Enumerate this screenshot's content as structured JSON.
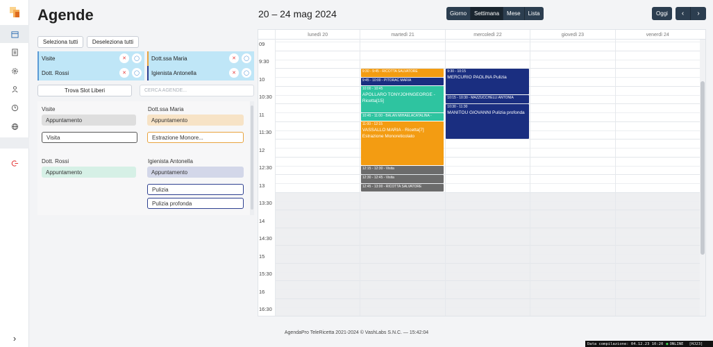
{
  "sidebar": {
    "items": [
      {
        "icon": "calendar-icon"
      },
      {
        "icon": "list-icon"
      },
      {
        "icon": "gear-icon"
      },
      {
        "icon": "user-icon"
      },
      {
        "icon": "clock-icon"
      },
      {
        "icon": "globe-icon"
      },
      {
        "icon": "logout-icon"
      }
    ],
    "expand_icon": "›"
  },
  "header": {
    "title": "Agende",
    "date_range": "20 – 24 mag 2024",
    "views": [
      "Giorno",
      "Settimana",
      "Mese",
      "Lista"
    ],
    "active_view": "Settimana",
    "today_label": "Oggi",
    "prev_label": "‹",
    "next_label": "›"
  },
  "agenda_panel": {
    "select_all": "Seleziona tutti",
    "deselect_all": "Deseleziona tutti",
    "find_slots": "Trova Slot Liberi",
    "search_placeholder": "CERCA AGENDE...",
    "agendas": [
      {
        "name": "Visite",
        "color": "#5b9bd5"
      },
      {
        "name": "Dott. Rossi",
        "color": "#5b9bd5"
      },
      {
        "name": "Dott.ssa Maria",
        "color": "#e8a33d"
      },
      {
        "name": "Igienista Antonella",
        "color": "#2c3e8f"
      }
    ]
  },
  "service_lists": {
    "visite": {
      "title": "Visite",
      "appuntamento": "Appuntamento",
      "items": [
        "Visita"
      ]
    },
    "maria": {
      "title": "Dott.ssa Maria",
      "appuntamento": "Appuntamento",
      "items": [
        "Estrazione Monore..."
      ]
    },
    "rossi": {
      "title": "Dott. Rossi",
      "appuntamento": "Appuntamento"
    },
    "antonella": {
      "title": "Igienista Antonella",
      "appuntamento": "Appuntamento",
      "items": [
        "Pulizia",
        "Pulizia profonda"
      ]
    }
  },
  "calendar": {
    "days": [
      "lunedì 20",
      "martedì 21",
      "mercoledì 22",
      "giovedì 23",
      "venerdì 24"
    ],
    "times": [
      "09",
      "9:30",
      "10",
      "10:30",
      "11",
      "11:30",
      "12",
      "12:30",
      "13",
      "13:30",
      "14",
      "14:30",
      "15",
      "15:30",
      "16",
      "16:30"
    ],
    "events": [
      {
        "day": 1,
        "start": "9:30",
        "end": "9:45",
        "time": "9:30 - 9:45",
        "title": "RICOTTA SALVATORE",
        "color": "#f39c12"
      },
      {
        "day": 1,
        "start": "9:45",
        "end": "10:00",
        "time": "9:45 - 10:00",
        "title": "PITORAC MARIA",
        "color": "#1a2e80"
      },
      {
        "day": 1,
        "start": "10:00",
        "end": "10:45",
        "time": "10:00 - 10:45",
        "title": "APOLLARO TONYJOHNGEORGE - Ricetta[15]",
        "color": "#2ec4a0"
      },
      {
        "day": 1,
        "start": "10:45",
        "end": "11:00",
        "time": "10:45 - 11:00",
        "title": "BALAN MIHAELACATALINA -",
        "color": "#2ec4a0"
      },
      {
        "day": 1,
        "start": "11:00",
        "end": "12:15",
        "time": "11:00 - 12:15",
        "title": "VASSALLO MARIA - Ricetta[7] Estrazione Monoreticolato",
        "color": "#f39c12"
      },
      {
        "day": 1,
        "start": "12:15",
        "end": "12:30",
        "time": "12:15 - 12:30",
        "title": "Visita",
        "color": "#6b6b6b"
      },
      {
        "day": 1,
        "start": "12:30",
        "end": "12:45",
        "time": "12:30 - 12:45",
        "title": "Visita",
        "color": "#6b6b6b"
      },
      {
        "day": 1,
        "start": "12:45",
        "end": "13:00",
        "time": "12:45 - 13:00",
        "title": "RICOTTA SALVATORE",
        "color": "#6b6b6b"
      },
      {
        "day": 2,
        "start": "9:30",
        "end": "10:15",
        "time": "9:30 - 10:15",
        "title": "MERCURIO PAOLINA Pulizia",
        "color": "#1a2e80"
      },
      {
        "day": 2,
        "start": "10:15",
        "end": "10:30",
        "time": "10:15 - 10:30",
        "title": "MAZZUCCHELLI ANTONIA",
        "color": "#1a2e80"
      },
      {
        "day": 2,
        "start": "10:30",
        "end": "11:30",
        "time": "10:30 - 11:30",
        "title": "MANITOU GIOVANNI Pulizia profonda",
        "color": "#1a2e80"
      }
    ],
    "closed": [
      {
        "day": 0,
        "from": "13:00",
        "to": "16:30",
        "color": "#eeeff1"
      },
      {
        "day": 1,
        "from": "13:00",
        "to": "16:30",
        "color": "#eeeff1"
      },
      {
        "day": 2,
        "from": "13:00",
        "to": "16:30",
        "color": "#eeeff1"
      },
      {
        "day": 3,
        "from": "13:00",
        "to": "16:30",
        "color": "#eeeff1"
      },
      {
        "day": 4,
        "from": "13:00",
        "to": "16:30",
        "color": "#eeeff1"
      }
    ]
  },
  "footer": {
    "text": "AgendaPro TeleRicetta 2021-2024 © VashLabs S.N.C. — 15:42:04",
    "compile_label": "Data compilazione: 04.12.23 10:20",
    "online": "ONLINE",
    "version": "[HJ23]"
  }
}
